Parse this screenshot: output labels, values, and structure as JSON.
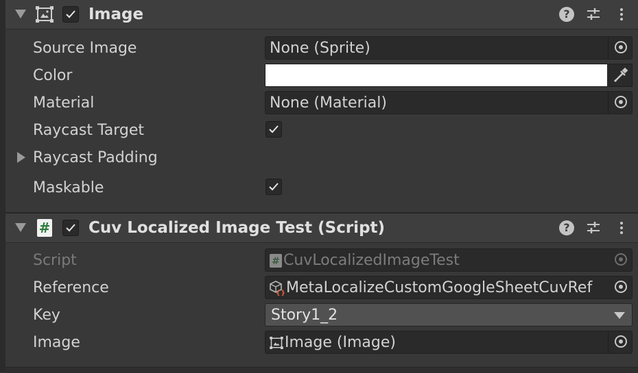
{
  "image_component": {
    "title": "Image",
    "enabled": true,
    "fields": {
      "source_image": {
        "label": "Source Image",
        "value": "None (Sprite)"
      },
      "color": {
        "label": "Color",
        "value": "#ffffff"
      },
      "material": {
        "label": "Material",
        "value": "None (Material)"
      },
      "raycast_target": {
        "label": "Raycast Target",
        "checked": true
      },
      "raycast_padding": {
        "label": "Raycast Padding",
        "expanded": false
      },
      "maskable": {
        "label": "Maskable",
        "checked": true
      }
    }
  },
  "script_component": {
    "title": "Cuv Localized Image Test (Script)",
    "enabled": true,
    "fields": {
      "script": {
        "label": "Script",
        "value": "CuvLocalizedImageTest"
      },
      "reference": {
        "label": "Reference",
        "value": "MetaLocalizeCustomGoogleSheetCuvRef"
      },
      "key": {
        "label": "Key",
        "value": "Story1_2"
      },
      "image": {
        "label": "Image",
        "value": "Image (Image)"
      }
    }
  },
  "header_icons": [
    "help-icon",
    "preset-icon",
    "more-options-icon"
  ],
  "icon_glyphs": {
    "script": "#",
    "help": "?"
  }
}
